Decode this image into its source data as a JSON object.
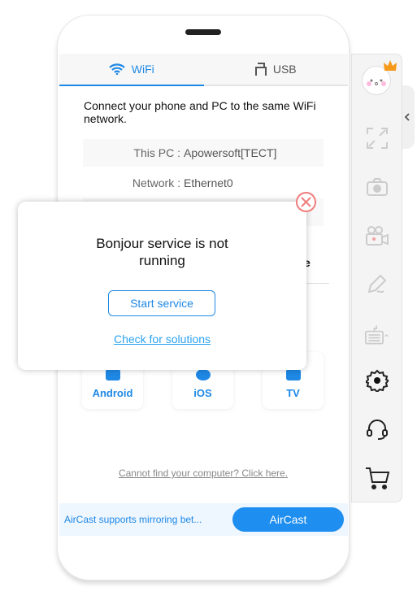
{
  "tabs": [
    {
      "label": "WiFi",
      "icon": "wifi-icon",
      "active": true
    },
    {
      "label": "USB",
      "icon": "usb-icon",
      "active": false
    }
  ],
  "intro": "Connect your phone and PC to the same WiFi network.",
  "info": [
    {
      "key": "This PC :",
      "value": "Apowersoft[TECT]"
    },
    {
      "key": "Network :",
      "value": "Ethernet0"
    }
  ],
  "partial_heading": "e",
  "devices": [
    {
      "label": "Android",
      "icon": "android-icon"
    },
    {
      "label": "iOS",
      "icon": "apple-icon"
    },
    {
      "label": "TV",
      "icon": "tv-icon"
    }
  ],
  "cannot_find": "Cannot find your computer? Click here.",
  "bottom": {
    "message": "AirCast supports mirroring bet...",
    "button": "AirCast"
  },
  "modal": {
    "title": "Bonjour service is not running",
    "button": "Start service",
    "link": "Check for solutions"
  },
  "sidebar": [
    "avatar",
    "fullscreen-icon",
    "camera-icon",
    "record-icon",
    "pen-icon",
    "keyboard-icon",
    "settings-icon",
    "headset-icon",
    "cart-icon"
  ],
  "colors": {
    "accent": "#1e88e5",
    "close": "#f07c7c",
    "bottom_bg": "#eef6ff"
  }
}
